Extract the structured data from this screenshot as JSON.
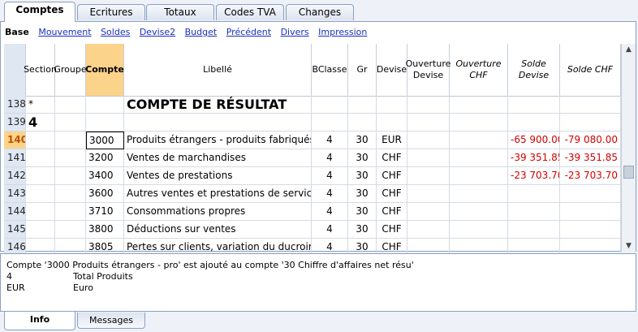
{
  "tabs": [
    "Comptes",
    "Ecritures",
    "Totaux",
    "Codes TVA",
    "Changes"
  ],
  "subnav": {
    "current": "Base",
    "links": [
      "Mouvement",
      "Soldes",
      "Devise2",
      "Budget",
      "Précédent",
      "Divers",
      "Impression"
    ]
  },
  "columns": {
    "section": "Section",
    "groupe": "Groupe",
    "compte": "Compte",
    "libelle": "Libellé",
    "bclasse": "BClasse",
    "gr": "Gr",
    "devise": "Devise",
    "ouverture_devise": "Ouverture Devise",
    "ouverture_chf": "Ouverture CHF",
    "solde_devise": "Solde Devise",
    "solde_chf": "Solde CHF"
  },
  "rows": [
    {
      "num": "138",
      "section": "*",
      "groupe": "",
      "compte": "",
      "libelle": "COMPTE DE RÉSULTAT",
      "bclasse": "",
      "gr": "",
      "devise": "",
      "solde_devise": "",
      "solde_chf": ""
    },
    {
      "num": "139",
      "section": "4",
      "groupe": "",
      "compte": "",
      "libelle": "",
      "bclasse": "",
      "gr": "",
      "devise": "",
      "solde_devise": "",
      "solde_chf": ""
    },
    {
      "num": "140",
      "section": "",
      "groupe": "",
      "compte": "3000",
      "libelle": "Produits étrangers -  produits fabriqués",
      "bclasse": "4",
      "gr": "30",
      "devise": "EUR",
      "solde_devise": "-65 900.00",
      "solde_chf": "-79 080.00"
    },
    {
      "num": "141",
      "section": "",
      "groupe": "",
      "compte": "3200",
      "libelle": "Ventes de marchandises",
      "bclasse": "4",
      "gr": "30",
      "devise": "CHF",
      "solde_devise": "-39 351.85",
      "solde_chf": "-39 351.85"
    },
    {
      "num": "142",
      "section": "",
      "groupe": "",
      "compte": "3400",
      "libelle": "Ventes de prestations",
      "bclasse": "4",
      "gr": "30",
      "devise": "CHF",
      "solde_devise": "-23 703.70",
      "solde_chf": "-23 703.70"
    },
    {
      "num": "143",
      "section": "",
      "groupe": "",
      "compte": "3600",
      "libelle": "Autres ventes et prestations de services",
      "bclasse": "4",
      "gr": "30",
      "devise": "CHF",
      "solde_devise": "",
      "solde_chf": ""
    },
    {
      "num": "144",
      "section": "",
      "groupe": "",
      "compte": "3710",
      "libelle": "Consommations propres",
      "bclasse": "4",
      "gr": "30",
      "devise": "CHF",
      "solde_devise": "",
      "solde_chf": ""
    },
    {
      "num": "145",
      "section": "",
      "groupe": "",
      "compte": "3800",
      "libelle": "Déductions sur ventes",
      "bclasse": "4",
      "gr": "30",
      "devise": "CHF",
      "solde_devise": "",
      "solde_chf": ""
    },
    {
      "num": "146",
      "section": "",
      "groupe": "",
      "compte": "3805",
      "libelle": "Pertes sur clients, variation du ducroire",
      "bclasse": "4",
      "gr": "30",
      "devise": "CHF",
      "solde_devise": "",
      "solde_chf": ""
    }
  ],
  "info": {
    "message": "Compte '3000 Produits étrangers - pro' est ajouté au compte '30 Chiffre d'affaires net résu'",
    "lines": [
      {
        "key": "4",
        "value": "Total Produits"
      },
      {
        "key": "EUR",
        "value": "Euro"
      }
    ]
  },
  "bottom_tabs": [
    "Info",
    "Messages"
  ]
}
